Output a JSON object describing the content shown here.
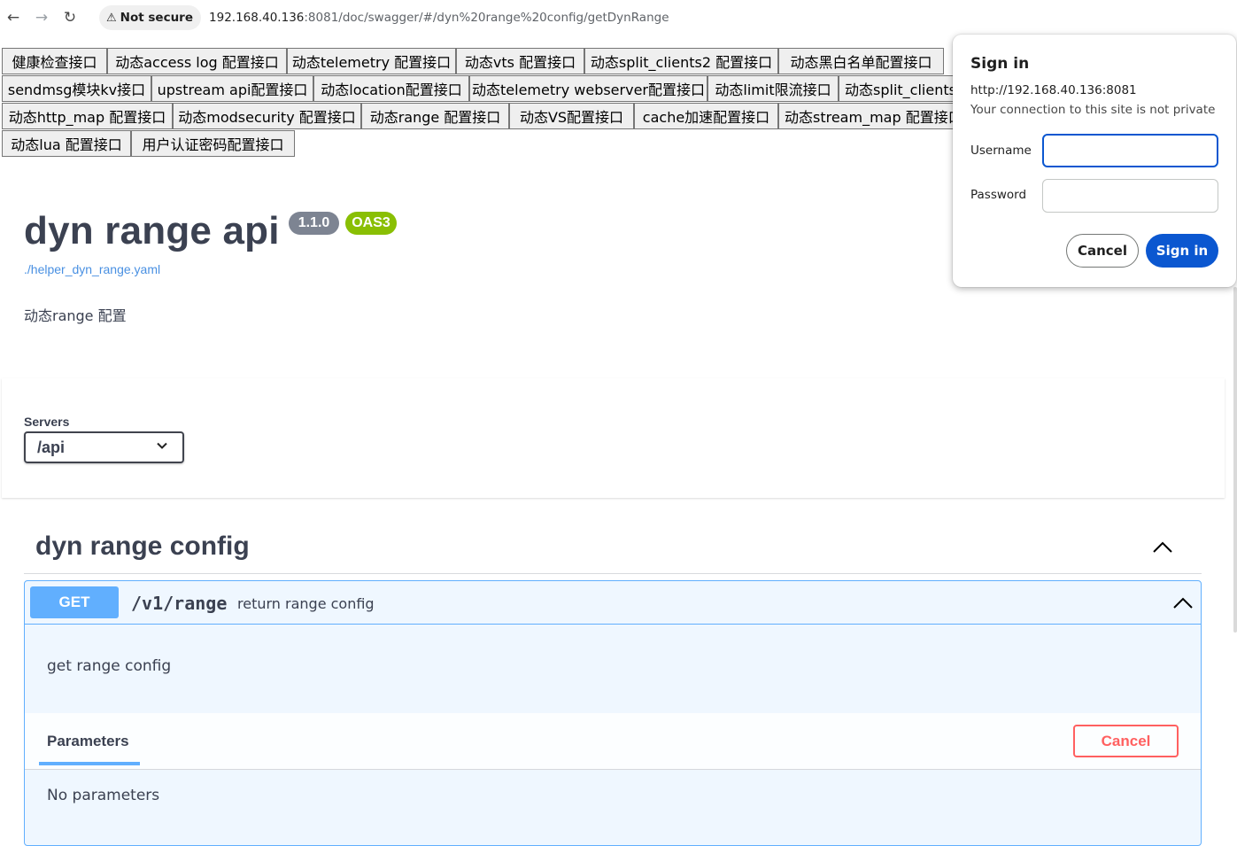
{
  "browser": {
    "security_label": "Not secure",
    "url_host": "192.168.40.136",
    "url_rest": ":8081/doc/swagger/#/dyn%20range%20config/getDynRange"
  },
  "nav_buttons": [
    "健康检查接口",
    "动态access log 配置接口",
    "动态telemetry 配置接口",
    "动态vts 配置接口",
    "动态split_clients2 配置接口",
    "动态黑白名单配置接口",
    "sendmsg模块kv接口",
    "upstream api配置接口",
    "动态location配置接口",
    "动态telemetry webserver配置接口",
    "动态limit限流接口",
    "动态split_clients",
    "动态http_map 配置接口",
    "动态modsecurity 配置接口",
    "动态range 配置接口",
    "动态VS配置接口",
    "cache加速配置接口",
    "动态stream_map 配置接口",
    "动态lua 配置接口",
    "用户认证密码配置接口"
  ],
  "info": {
    "title": "dyn range api",
    "version": "1.1.0",
    "oas": "OAS3",
    "spec_link": "./helper_dyn_range.yaml",
    "description": "动态range 配置"
  },
  "servers": {
    "label": "Servers",
    "selected": "/api"
  },
  "tag": {
    "title": "dyn range config"
  },
  "operation": {
    "method": "GET",
    "path": "/v1/range",
    "summary": "return range config",
    "description": "get range config",
    "params_tab": "Parameters",
    "cancel_label": "Cancel",
    "no_params": "No parameters"
  },
  "dialog": {
    "title": "Sign in",
    "origin": "http://192.168.40.136:8081",
    "warning": "Your connection to this site is not private",
    "username_label": "Username",
    "password_label": "Password",
    "cancel": "Cancel",
    "signin": "Sign in"
  },
  "colors": {
    "get": "#61affe",
    "oas": "#89bf04",
    "cancel": "#ff6060",
    "primary_button": "#0b57d0"
  }
}
